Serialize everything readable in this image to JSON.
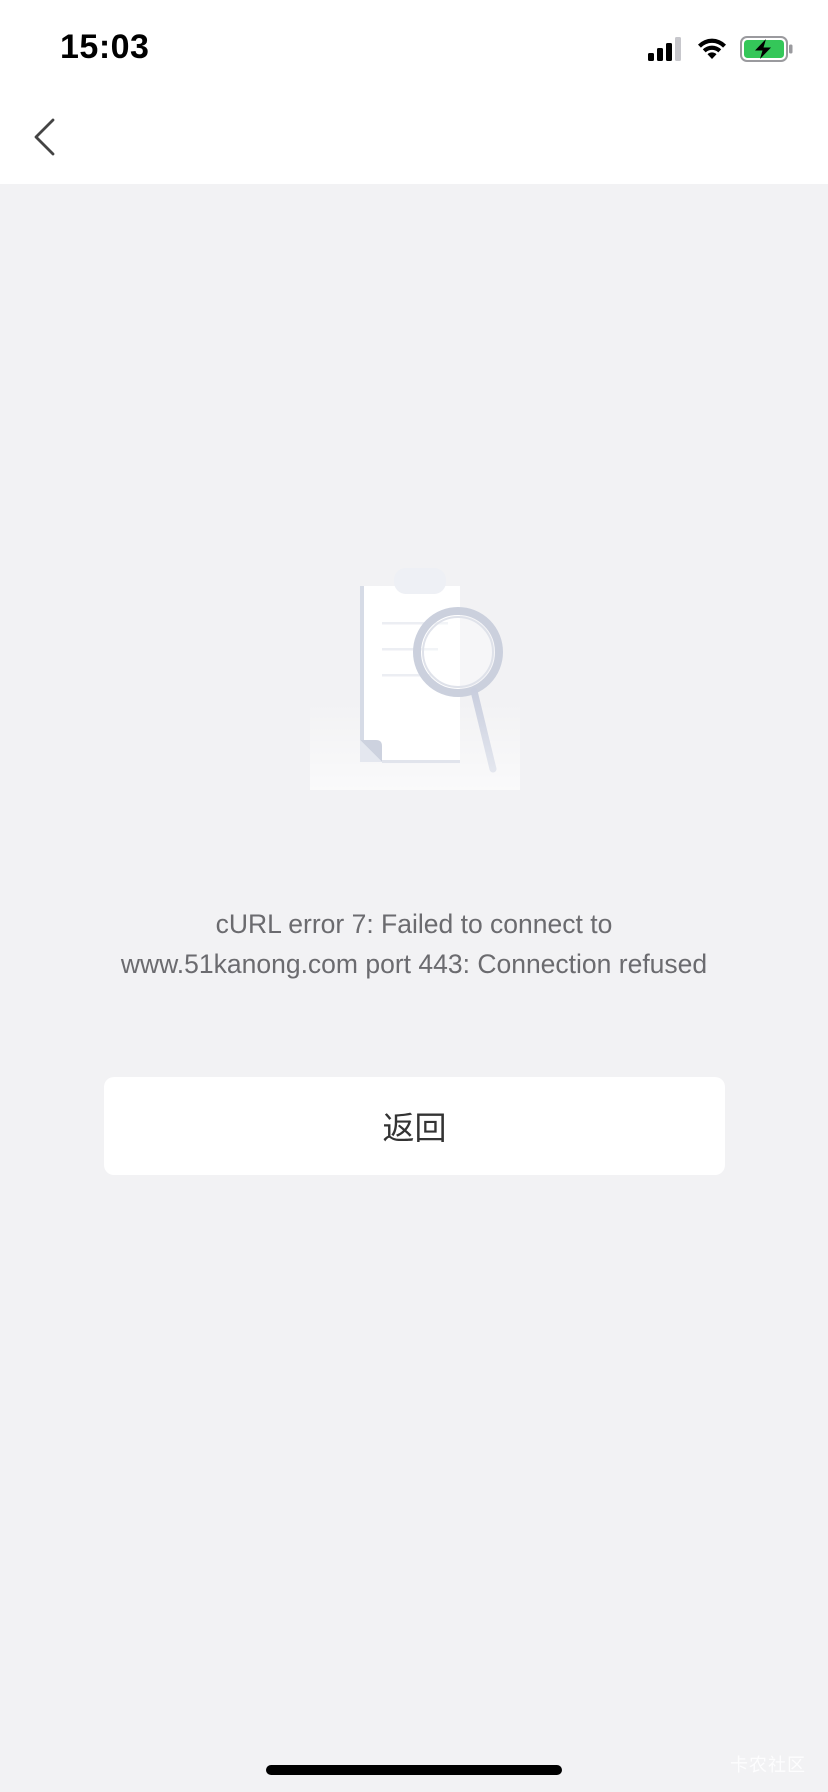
{
  "status_bar": {
    "time": "15:03",
    "icons": [
      "cellular-signal-icon",
      "wifi-icon",
      "battery-charging-icon"
    ],
    "battery_color": "#34c759"
  },
  "nav": {
    "back_icon": "chevron-left-icon"
  },
  "empty_state": {
    "illustration_icon": "clipboard-magnifier-icon",
    "message": "cURL error 7: Failed to connect to www.51kanong.com port 443: Connection refused",
    "button_label": "返回"
  },
  "watermark": "卡农社区",
  "colors": {
    "background": "#f2f2f4",
    "surface": "#ffffff",
    "message_text": "#6b6b6f",
    "button_text": "#333333"
  }
}
